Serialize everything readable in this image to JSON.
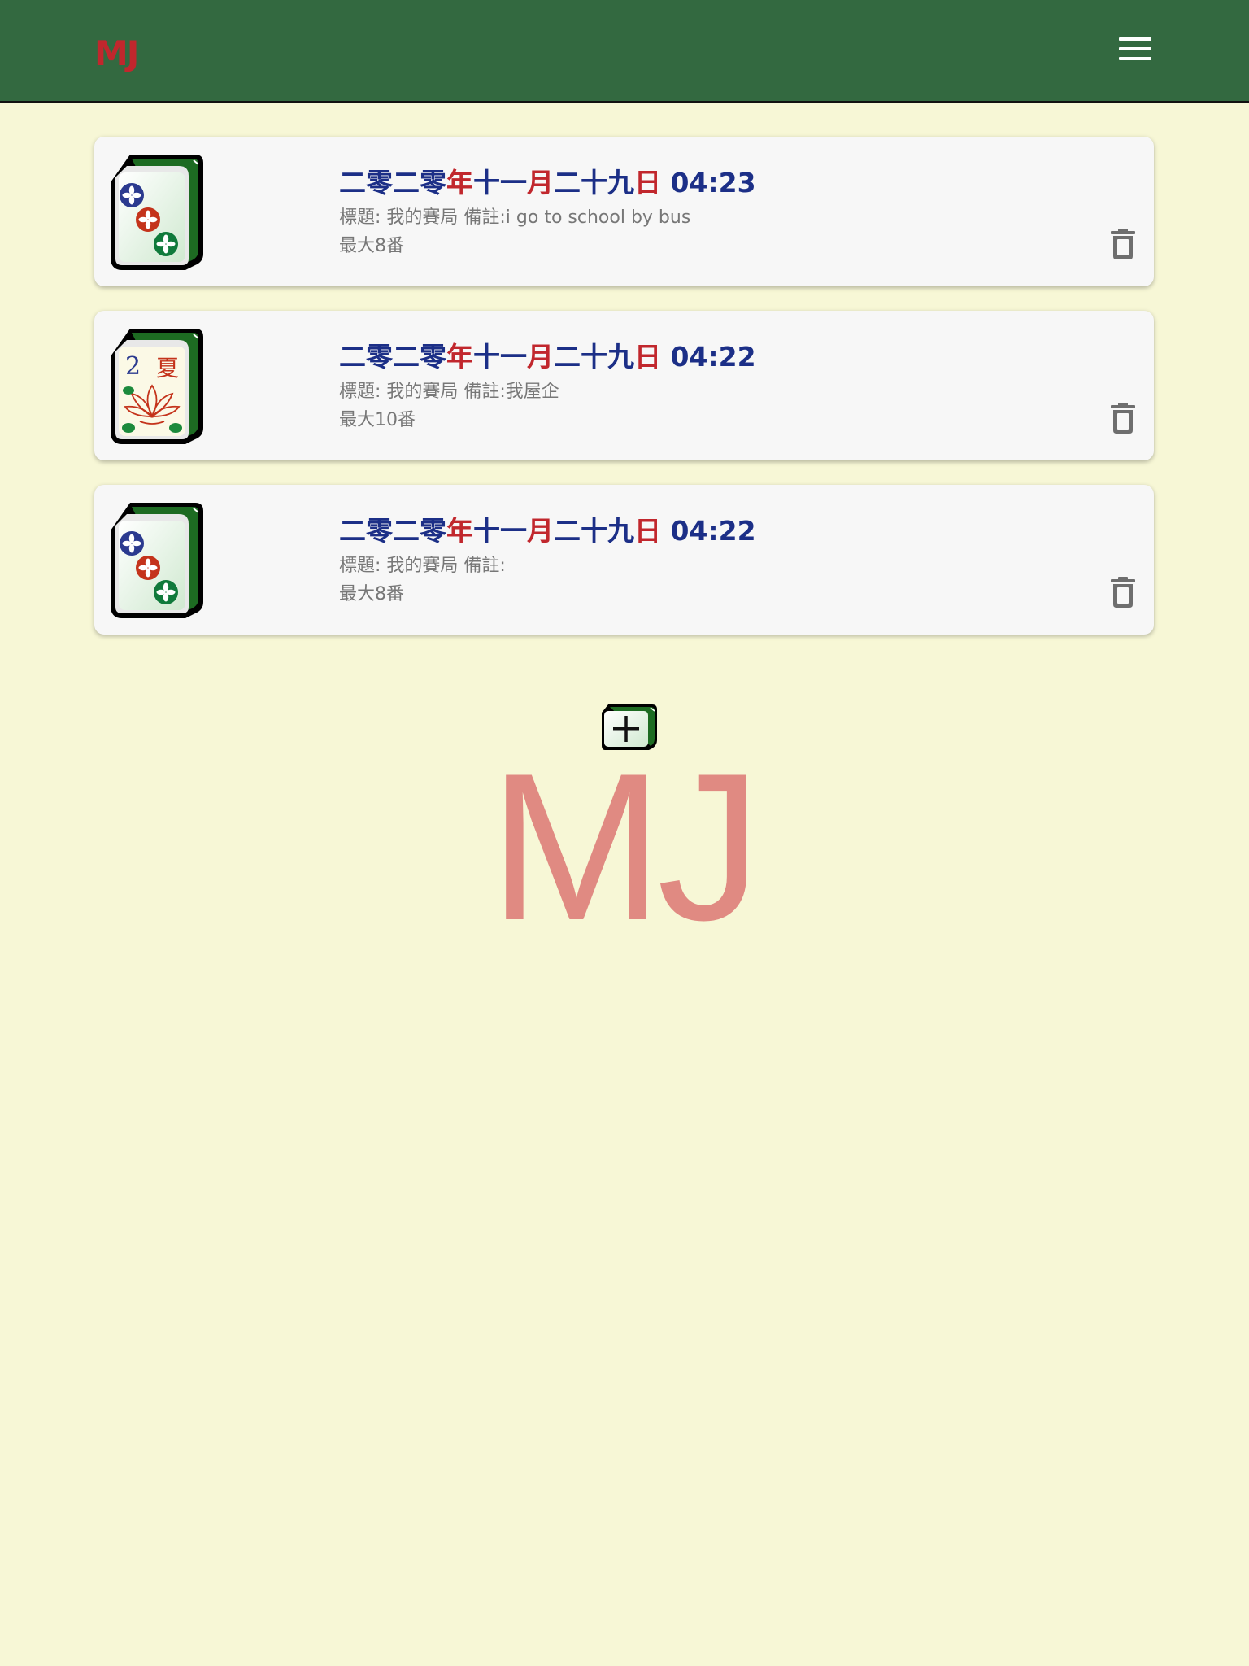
{
  "header": {
    "logo": "MJ",
    "menu_icon": "hamburger-menu-icon"
  },
  "games": [
    {
      "tile_icon": "mahjong-three-circles-icon",
      "date": {
        "y": "二零二零",
        "yu": "年",
        "m": "十一",
        "mu": "月",
        "d": "二十九",
        "du": "日"
      },
      "time": "04:23",
      "details": "標題: 我的賽局 備註:i go to school by bus",
      "max": "最大8番"
    },
    {
      "tile_icon": "mahjong-summer-flower-icon",
      "tile_number": "2",
      "tile_char": "夏",
      "date": {
        "y": "二零二零",
        "yu": "年",
        "m": "十一",
        "mu": "月",
        "d": "二十九",
        "du": "日"
      },
      "time": "04:22",
      "details": "標題: 我的賽局 備註:我屋企",
      "max": "最大10番"
    },
    {
      "tile_icon": "mahjong-three-circles-icon",
      "date": {
        "y": "二零二零",
        "yu": "年",
        "m": "十一",
        "mu": "月",
        "d": "二十九",
        "du": "日"
      },
      "time": "04:22",
      "details": "標題: 我的賽局 備註:",
      "max": "最大8番"
    }
  ],
  "add_button": {
    "icon": "add-tile-icon"
  },
  "watermark": "MJ",
  "colors": {
    "appbar": "#336940",
    "background": "#f7f7d6",
    "title_blue": "#1c2f87",
    "accent_red": "#c1272d",
    "watermark": "#e08a82"
  }
}
